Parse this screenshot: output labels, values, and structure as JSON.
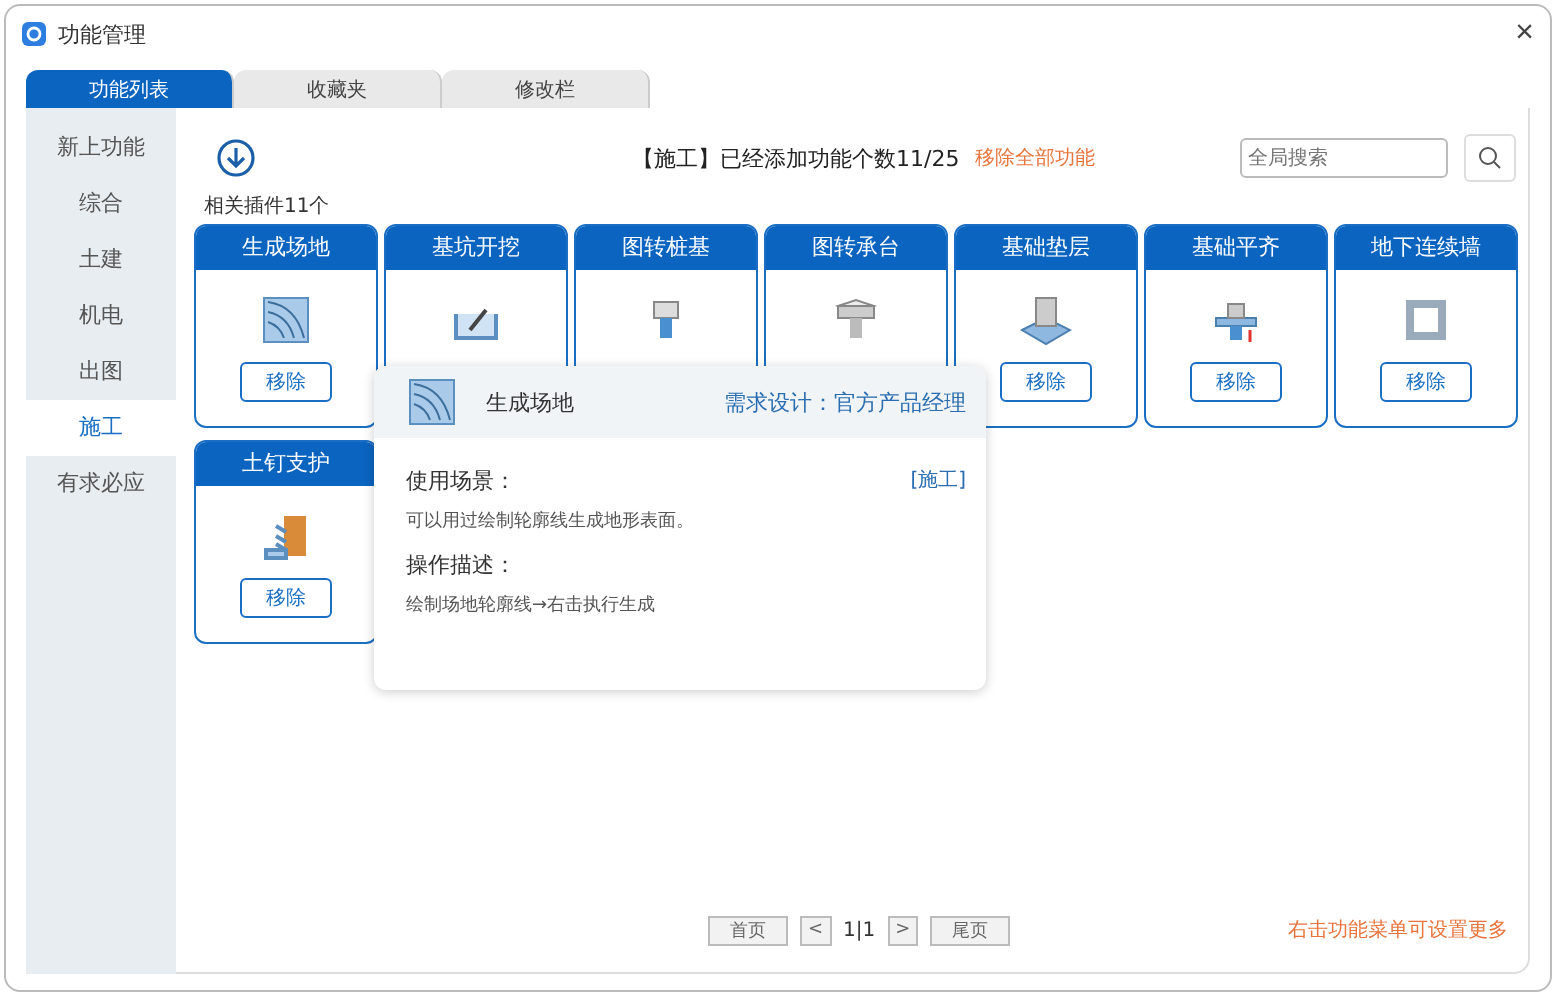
{
  "window": {
    "title": "功能管理",
    "close": "×"
  },
  "tabs": [
    {
      "label": "功能列表",
      "selected": true
    },
    {
      "label": "收藏夹",
      "selected": false
    },
    {
      "label": "修改栏",
      "selected": false
    }
  ],
  "sidebar": {
    "items": [
      {
        "label": "新上功能",
        "selected": false
      },
      {
        "label": "综合",
        "selected": false
      },
      {
        "label": "土建",
        "selected": false
      },
      {
        "label": "机电",
        "selected": false
      },
      {
        "label": "出图",
        "selected": false
      },
      {
        "label": "施工",
        "selected": true
      },
      {
        "label": "有求必应",
        "selected": false
      }
    ]
  },
  "header": {
    "summary": "【施工】已经添加功能个数11/25",
    "remove_all": "移除全部功能",
    "count": "相关插件11个",
    "search": {
      "placeholder": "全局搜索"
    }
  },
  "cards": [
    {
      "title": "生成场地",
      "button": "移除"
    },
    {
      "title": "基坑开挖"
    },
    {
      "title": "图转桩基"
    },
    {
      "title": "图转承台"
    },
    {
      "title": "基础垫层",
      "button": "移除"
    },
    {
      "title": "基础平齐",
      "button": "移除"
    },
    {
      "title": "地下连续墙",
      "button": "移除"
    },
    {
      "title": "土钉支护",
      "button": "移除"
    }
  ],
  "tooltip": {
    "title": "生成场地",
    "designer": "需求设计：官方产品经理",
    "usage_label": "使用场景：",
    "category": "[施工]",
    "usage": "可以用过绘制轮廓线生成地形表面。",
    "steps_label": "操作描述：",
    "steps": "绘制场地轮廓线→右击执行生成"
  },
  "pager": {
    "first": "首页",
    "prev": "<",
    "page": "1|1",
    "next": ">",
    "last": "尾页"
  },
  "hint": "右击功能菜单可设置更多"
}
